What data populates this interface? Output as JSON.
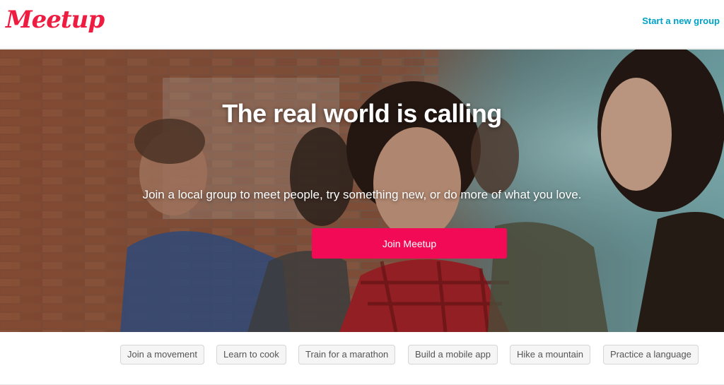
{
  "header": {
    "logo_text": "Meetup",
    "start_group_label": "Start a new group"
  },
  "hero": {
    "title": "The real world is calling",
    "subtitle": "Join a local group to meet people, try something new, or do more of what you love.",
    "cta_label": "Join Meetup"
  },
  "topics": [
    {
      "label": "Join a movement"
    },
    {
      "label": "Learn to cook"
    },
    {
      "label": "Train for a marathon"
    },
    {
      "label": "Build a mobile app"
    },
    {
      "label": "Hike a mountain"
    },
    {
      "label": "Practice a language"
    }
  ],
  "colors": {
    "brand": "#ed1c40",
    "cta": "#f20a56",
    "link": "#00a2c7"
  }
}
